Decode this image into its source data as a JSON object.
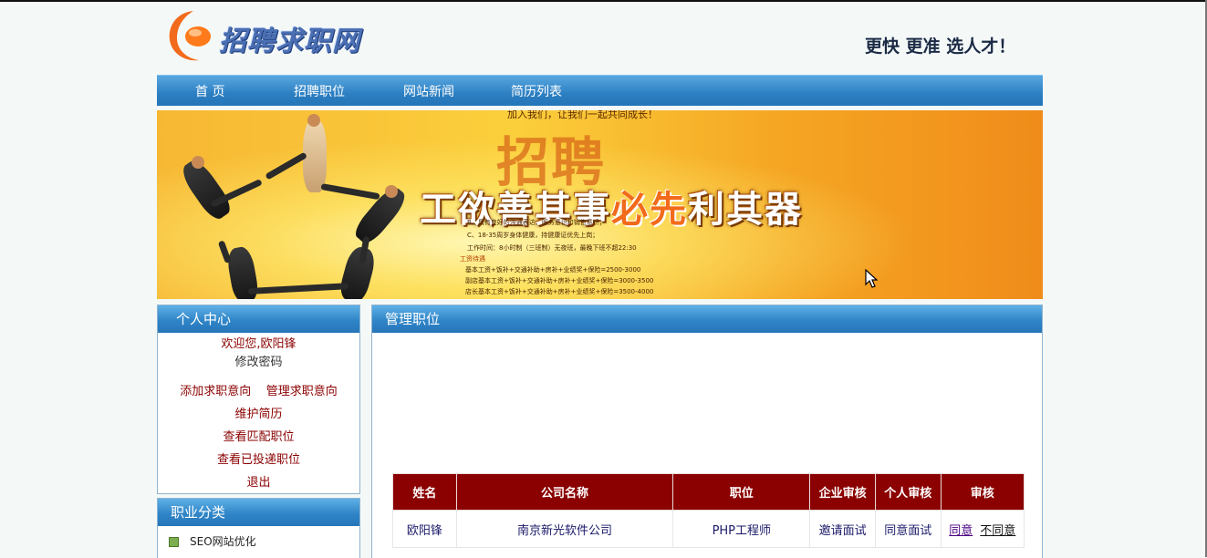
{
  "site": {
    "logo_text": "招聘求职网",
    "slogan": "更快 更准 选人才！"
  },
  "nav": [
    "首 页",
    "招聘职位",
    "网站新闻",
    "简历列表"
  ],
  "banner": {
    "top_note": "加入我们，让我们一起共同成长！",
    "big_char": "招聘",
    "headline_part1": "工欲善其事",
    "headline_part2": "必先",
    "headline_part3": "利其器",
    "lines": [
      "B、具有良好的沟通表达、服务意识和销售意识；",
      "C、18-35周岁身体健康，持健康证优先上岗；",
      "工作时间：8小时制（三班制）无夜班，最晚下班不超22:30",
      "工资待遇",
      "基本工资+饭补+交通补助+房补+业绩奖+保险=2500-3000",
      "副店基本工资+饭补+交通补助+房补+业绩奖+保险=3000-3500",
      "店长基本工资+饭补+交通补助+房补+业绩奖+保险=3500-4000"
    ]
  },
  "personal_center": {
    "title": "个人中心",
    "welcome": "欢迎您,欧阳锋",
    "change_password": "修改密码",
    "add_intention": "添加求职意向",
    "manage_intention": "管理求职意向",
    "maintain_resume": "维护简历",
    "view_matched": "查看匹配职位",
    "view_applied": "查看已投递职位",
    "logout": "退出"
  },
  "job_category": {
    "title": "职业分类",
    "items": [
      "SEO网站优化"
    ]
  },
  "manage_jobs": {
    "title": "管理职位",
    "columns": [
      "姓名",
      "公司名称",
      "职位",
      "企业审核",
      "个人审核",
      "审核"
    ],
    "rows": [
      {
        "name": "欧阳锋",
        "company": "南京新光软件公司",
        "position": "PHP工程师",
        "company_review": "邀请面试",
        "personal_review": "同意面试",
        "agree": "同意",
        "disagree": "不同意"
      }
    ]
  },
  "colors": {
    "nav_blue": "#2c7fc2",
    "header_red": "#8b0000",
    "link_red": "#8b0000"
  }
}
